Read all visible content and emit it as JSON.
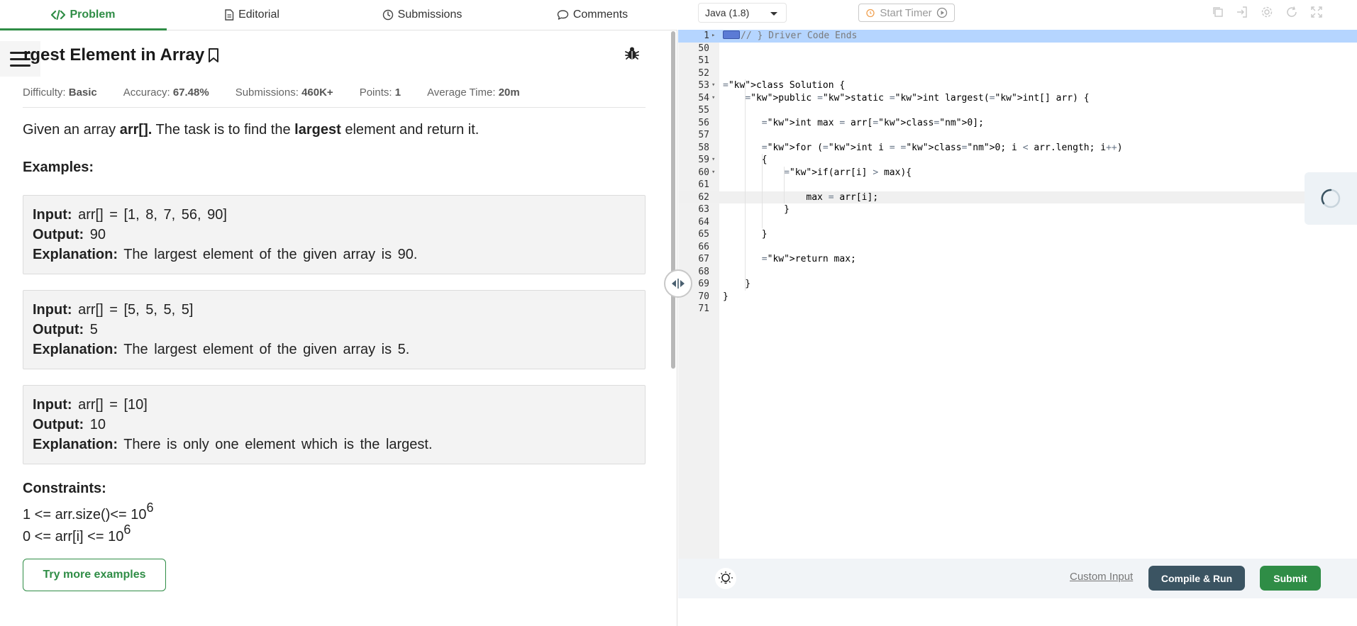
{
  "tabs": {
    "problem": "Problem",
    "editorial": "Editorial",
    "submissions": "Submissions",
    "comments": "Comments"
  },
  "problem": {
    "title": "rgest Element in Array",
    "meta": {
      "difficulty_label": "Difficulty:",
      "difficulty": "Basic",
      "accuracy_label": "Accuracy:",
      "accuracy": "67.48%",
      "submissions_label": "Submissions:",
      "submissions": "460K+",
      "points_label": "Points:",
      "points": "1",
      "avg_time_label": "Average Time:",
      "avg_time": "20m"
    },
    "description": {
      "part1": "Given an array ",
      "arr": "arr[].",
      "part2": " The task is to find the ",
      "largest": "largest",
      "part3": " element and return it."
    },
    "examples_heading": "Examples:",
    "examples": [
      {
        "input_label": "Input:",
        "input": "arr[] = [1, 8, 7, 56, 90]",
        "output_label": "Output:",
        "output": "90",
        "explanation_label": "Explanation:",
        "explanation": "The largest element of the given array is 90."
      },
      {
        "input_label": "Input:",
        "input": "arr[] = [5, 5, 5, 5]",
        "output_label": "Output:",
        "output": "5",
        "explanation_label": "Explanation:",
        "explanation": "The largest element of the given array is 5."
      },
      {
        "input_label": "Input:",
        "input": "arr[] = [10]",
        "output_label": "Output:",
        "output": "10",
        "explanation_label": "Explanation:",
        "explanation": "There is only one element which is the largest."
      }
    ],
    "constraints_heading": "Constraints:",
    "constraints": [
      {
        "text": "1 <= arr.size()<= 10",
        "sup": "6"
      },
      {
        "text": "0 <= arr[i] <= 10",
        "sup": "6"
      }
    ],
    "try_more_label": "Try more examples"
  },
  "editor": {
    "language": "Java (1.8)",
    "timer_label": "Start Timer",
    "active_line": "62",
    "lines": [
      {
        "n": "1",
        "fold": "▸",
        "code": "// } Driver Code Ends"
      },
      {
        "n": "50",
        "fold": "",
        "code": ""
      },
      {
        "n": "51",
        "fold": "",
        "code": ""
      },
      {
        "n": "52",
        "fold": "",
        "code": ""
      },
      {
        "n": "53",
        "fold": "▾",
        "code": "class Solution {"
      },
      {
        "n": "54",
        "fold": "▾",
        "code": "    public static int largest(int[] arr) {"
      },
      {
        "n": "55",
        "fold": "",
        "code": ""
      },
      {
        "n": "56",
        "fold": "",
        "code": "       int max = arr[0];"
      },
      {
        "n": "57",
        "fold": "",
        "code": ""
      },
      {
        "n": "58",
        "fold": "",
        "code": "       for (int i = 0; i < arr.length; i++)"
      },
      {
        "n": "59",
        "fold": "▾",
        "code": "       {"
      },
      {
        "n": "60",
        "fold": "▾",
        "code": "           if(arr[i] > max){"
      },
      {
        "n": "61",
        "fold": "",
        "code": ""
      },
      {
        "n": "62",
        "fold": "",
        "code": "               max = arr[i];"
      },
      {
        "n": "63",
        "fold": "",
        "code": "           }"
      },
      {
        "n": "64",
        "fold": "",
        "code": ""
      },
      {
        "n": "65",
        "fold": "",
        "code": "       }"
      },
      {
        "n": "66",
        "fold": "",
        "code": ""
      },
      {
        "n": "67",
        "fold": "",
        "code": "       return max;"
      },
      {
        "n": "68",
        "fold": "",
        "code": ""
      },
      {
        "n": "69",
        "fold": "",
        "code": "    }"
      },
      {
        "n": "70",
        "fold": "",
        "code": "}"
      },
      {
        "n": "71",
        "fold": "",
        "code": ""
      }
    ]
  },
  "footer": {
    "custom_input": "Custom Input",
    "compile_run": "Compile & Run",
    "submit": "Submit"
  },
  "colors": {
    "accent": "#2f8d46",
    "compile_bg": "#3b5462",
    "keyword": "#0000cc",
    "selection": "#b5d5ff"
  }
}
